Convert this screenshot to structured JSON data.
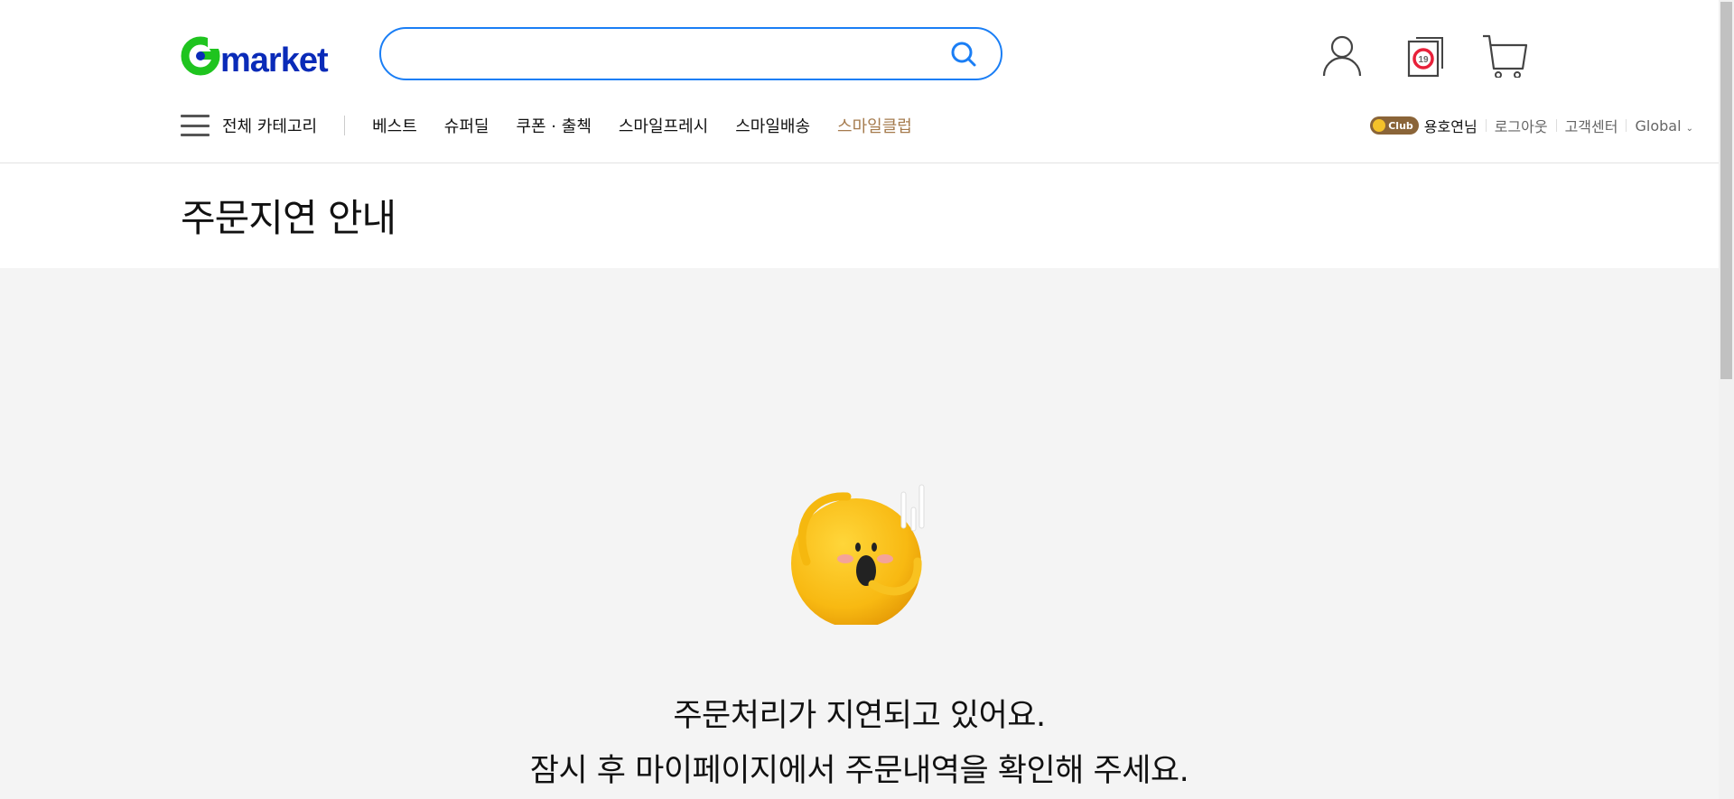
{
  "header": {
    "logo_text": "Gmarket",
    "search": {
      "value": "",
      "placeholder": ""
    },
    "icons": [
      "user-icon",
      "adult-19-icon",
      "cart-icon"
    ],
    "adult_badge": "19"
  },
  "nav": {
    "all_categories": "전체 카테고리",
    "items": [
      "베스트",
      "슈퍼딜",
      "쿠폰 · 출첵",
      "스마일프레시",
      "스마일배송",
      "스마일클럽"
    ]
  },
  "util": {
    "badge": "Club",
    "user_name": "용호연님",
    "logout": "로그아웃",
    "support": "고객센터",
    "global": "Global"
  },
  "page": {
    "title": "주문지연 안내",
    "message_line1": "주문처리가 지연되고 있어요.",
    "message_line2": "잠시 후 마이페이지에서 주문내역을 확인해 주세요."
  },
  "colors": {
    "brand_green": "#1fc41f",
    "brand_blue": "#0a2bb8",
    "search_border": "#1a7ef5",
    "club": "#a57b4e",
    "bg_gray": "#f4f4f4"
  }
}
